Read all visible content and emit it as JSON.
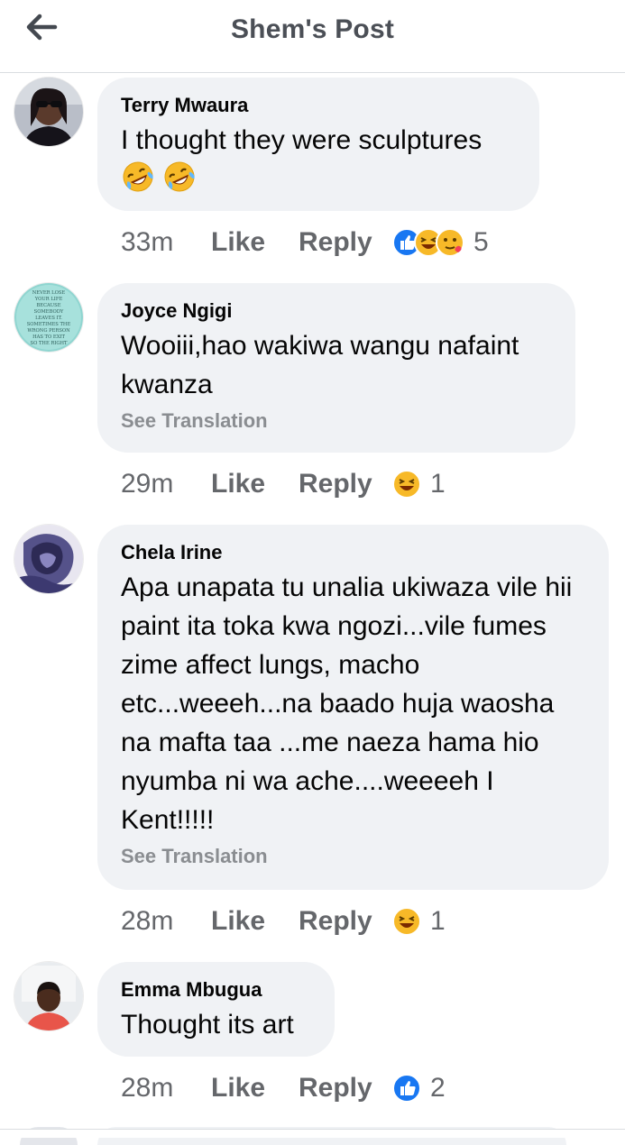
{
  "header": {
    "title": "Shem's Post"
  },
  "comments": [
    {
      "author": "Terry Mwaura",
      "text": "I thought they were sculptures",
      "time": "33m",
      "like": "Like",
      "reply": "Reply",
      "reaction_icons": [
        "like-icon",
        "laugh-icon",
        "love-icon"
      ],
      "reaction_count": "5",
      "see_translation": ""
    },
    {
      "author": "Joyce Ngigi",
      "text": "Wooiii,hao wakiwa wangu nafaint kwanza",
      "time": "29m",
      "like": "Like",
      "reply": "Reply",
      "reaction_icons": [
        "laugh-icon"
      ],
      "reaction_count": "1",
      "see_translation": "See Translation",
      "avatar_text": "NEVER LOSE YOUR LIFE BECAUSE SOMEBODY LEAVES IT. SOMETIMES THE WRONG PERSON HAS TO EXIT SO THE RIGHT PERSON CAN ENTER"
    },
    {
      "author": "Chela Irine",
      "text": "Apa unapata tu unalia ukiwaza vile hii paint ita toka kwa ngozi...vile fumes zime affect lungs, macho etc...weeeh...na baado huja waosha na mafta taa ...me naeza hama hio nyumba ni wa ache....weeeeh I Kent!!!!!",
      "time": "28m",
      "like": "Like",
      "reply": "Reply",
      "reaction_icons": [
        "laugh-icon"
      ],
      "reaction_count": "1",
      "see_translation": "See Translation"
    },
    {
      "author": "Emma Mbugua",
      "text": "Thought its art",
      "time": "28m",
      "like": "Like",
      "reply": "Reply",
      "reaction_icons": [
        "like-icon"
      ],
      "reaction_count": "2",
      "see_translation": ""
    }
  ],
  "colors": {
    "bubble": "#f0f2f5",
    "meta_text": "#65676b",
    "like_blue": "#1877f2",
    "laugh_yellow": "#f7b928"
  }
}
